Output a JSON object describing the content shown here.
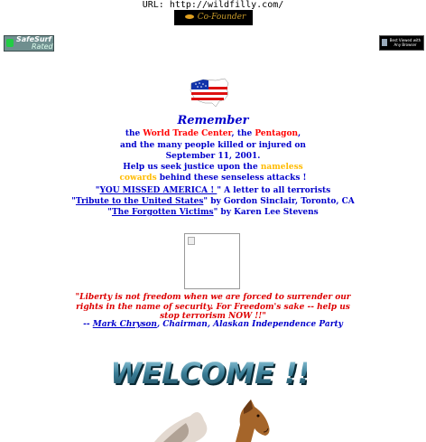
{
  "url_bar": {
    "text": "URL: http://wildfilly.com/"
  },
  "banner": {
    "text": "Co-Founder"
  },
  "badges": {
    "safesurf_top": "SafeSurf",
    "safesurf_bottom": "Rated",
    "best_viewed": "Best Viewed with Any Browser"
  },
  "memorial": {
    "heading": "Remember",
    "line1_a": "the ",
    "line1_wtc": "World Trade Center",
    "line1_b": ", the ",
    "line1_pentagon": "Pentagon",
    "line1_c": ",",
    "line2": "and the many people killed or injured on",
    "line3": "September 11,  2001.",
    "line4_a": "Help us seek justice upon the ",
    "line4_nameless": "nameless",
    "line5_cowards": "cowards",
    "line5_b": " behind these senseless attacks !"
  },
  "links": [
    {
      "pre": "\"",
      "link": "YOU MISSED AMERICA ! ",
      "post": "\"  A letter to all terrorists"
    },
    {
      "pre": "\"",
      "link": "Tribute to the United States",
      "post": "\" by Gordon Sinclair, Toronto, CA"
    },
    {
      "pre": "\"",
      "link": "The Forgotten Victims",
      "post": "\" by Karen Lee Stevens"
    }
  ],
  "quote": {
    "line1": "\"Liberty is not freedom when we are forced to surrender our",
    "line2": "rights in the name of security.  For Freedom's sake -- help us",
    "line3": "stop terrorism NOW !!\"",
    "attr_pre": "-- ",
    "attr_link": "Mark Chryson",
    "attr_post": ", Chairman, Alaskan Independence Party"
  },
  "welcome": {
    "text": "WELCOME !!"
  },
  "colors": {
    "blue": "#0000cc",
    "red": "#ff0000",
    "gold": "#ffbb00",
    "quote_red": "#dd0000"
  }
}
